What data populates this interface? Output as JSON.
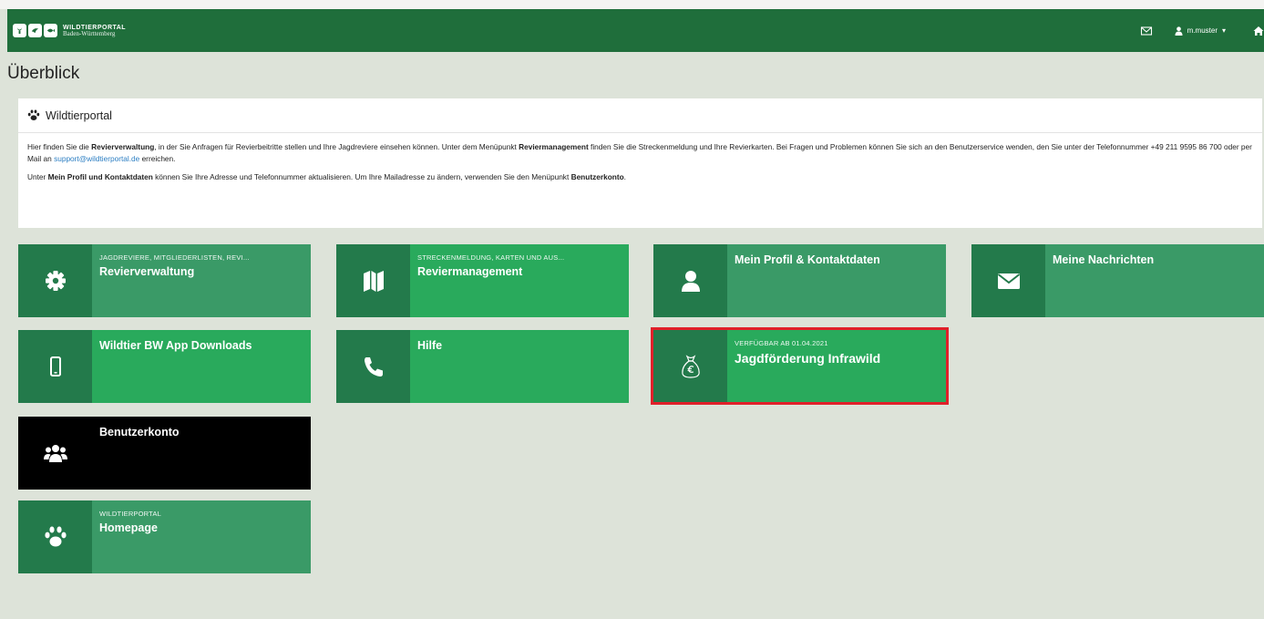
{
  "header": {
    "brand_title": "WILDTIERPORTAL",
    "brand_subtitle": "Baden-Württemberg",
    "username": "m.muster",
    "user_caret": "▾"
  },
  "page": {
    "title": "Überblick"
  },
  "intro": {
    "heading": "Wildtierportal",
    "p1_a": "Hier finden Sie die ",
    "p1_b": "Revierverwaltung",
    "p1_c": ", in der Sie Anfragen für Revierbeitritte stellen und Ihre Jagdreviere einsehen können. Unter dem Menüpunkt ",
    "p1_d": "Reviermanagement",
    "p1_e": " finden Sie die Streckenmeldung und Ihre Revierkarten. Bei Fragen und Problemen können Sie sich an den Benutzerservice wenden, den Sie unter der Telefonnummer +49 211 9595 86 700 oder per Mail an ",
    "p1_link": "support@wildtierportal.de",
    "p1_f": " erreichen.",
    "p2_a": "Unter ",
    "p2_b": "Mein Profil und Kontaktdaten",
    "p2_c": " können Sie Ihre Adresse und Telefonnummer aktualisieren. Um Ihre Mailadresse zu ändern, verwenden Sie den Menüpunkt ",
    "p2_d": "Benutzerkonto",
    "p2_e": "."
  },
  "tiles": [
    {
      "sub": "JAGDREVIERE, MITGLIEDERLISTEN, REVI...",
      "title": "Revierverwaltung",
      "icon": "gear-icon"
    },
    {
      "sub": "STRECKENMELDUNG, KARTEN UND AUS...",
      "title": "Reviermanagement",
      "icon": "map-icon"
    },
    {
      "sub": "",
      "title": "Mein Profil & Kontaktdaten",
      "icon": "user-icon"
    },
    {
      "sub": "",
      "title": "Meine Nachrichten",
      "icon": "envelope-icon"
    },
    {
      "sub": "",
      "title": "Wildtier BW App Downloads",
      "icon": "mobile-phone-icon"
    },
    {
      "sub": "",
      "title": "Hilfe",
      "icon": "phone-icon"
    },
    {
      "sub": "VERFÜGBAR AB 01.04.2021",
      "title": "Jagdförderung Infrawild",
      "icon": "money-bag-euro-icon"
    },
    {
      "sub": "",
      "title": "Benutzerkonto",
      "icon": "users-group-icon"
    },
    {
      "sub": "WILDTIERPORTAL",
      "title": "Homepage",
      "icon": "paw-icon"
    }
  ],
  "colors": {
    "navbar": "#1f6e3b",
    "tile_bright": "#29aa5c",
    "tile_mid": "#3a9a67",
    "tile_icon": "#237a4b",
    "highlight": "#e0202a",
    "link": "#2d7fc3"
  }
}
